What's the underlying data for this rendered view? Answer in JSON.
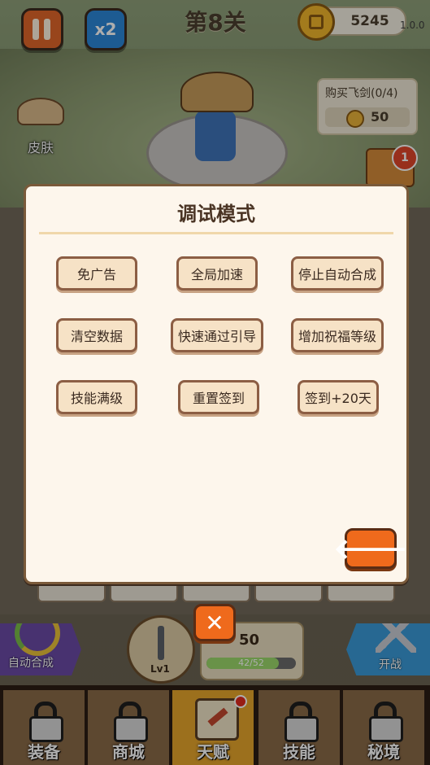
{
  "hud": {
    "level_title": "第8关",
    "speed": "x2",
    "coins": "5245",
    "version": "1.0.0",
    "buy_sword_title": "购买飞剑(0/4)",
    "buy_sword_cost": "50",
    "skin_label": "皮肤",
    "chest_badge": "1"
  },
  "modal": {
    "title": "调试模式",
    "buttons": [
      "免广告",
      "全局加速",
      "停止自动合成",
      "清空数据",
      "快速通过引导",
      "增加祝福等级",
      "技能满级",
      "重置签到",
      "签到+20天"
    ],
    "back_icon": "arrow-left-icon"
  },
  "controls": {
    "auto_merge": "自动合成",
    "sword_level": "Lv1",
    "cost": "50",
    "progress_text": "42/52",
    "progress": 0.8077,
    "battle": "开战",
    "close_icon": "close-icon"
  },
  "nav": {
    "tabs": [
      "装备",
      "商城",
      "天赋",
      "技能",
      "秘境"
    ],
    "active": "天赋"
  },
  "colors": {
    "modal_bg": "#fdf6ec",
    "button_bg": "#f6e2c6",
    "accent_orange": "#ef6a1c",
    "active_tab": "#e6a52c"
  }
}
